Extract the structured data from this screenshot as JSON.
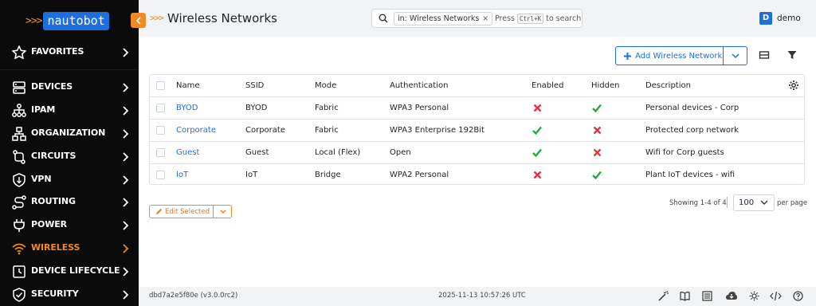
{
  "brand": {
    "chevrons": ">>>",
    "name": "nautobot"
  },
  "sidebar": {
    "favorites": "FAVORITES",
    "items": [
      {
        "label": "DEVICES",
        "icon": "server-icon"
      },
      {
        "label": "IPAM",
        "icon": "ipam-icon"
      },
      {
        "label": "ORGANIZATION",
        "icon": "organization-icon"
      },
      {
        "label": "CIRCUITS",
        "icon": "circuit-icon"
      },
      {
        "label": "VPN",
        "icon": "vpn-shield-icon"
      },
      {
        "label": "ROUTING",
        "icon": "routing-icon"
      },
      {
        "label": "POWER",
        "icon": "power-plug-icon"
      },
      {
        "label": "WIRELESS",
        "icon": "wifi-icon",
        "active": true
      },
      {
        "label": "DEVICE LIFECYCLE",
        "icon": "lifecycle-icon"
      },
      {
        "label": "SECURITY",
        "icon": "shield-check-icon"
      }
    ]
  },
  "header": {
    "title_chevrons": ">>>",
    "title": "Wireless Networks",
    "search": {
      "chip": "in: Wireless Networks",
      "chip_close": "×",
      "press": "Press",
      "kbd": "Ctrl+K",
      "to_search": "to search"
    },
    "user": {
      "initial": "D",
      "name": "demo"
    }
  },
  "toolbar": {
    "add_label": "Add Wireless Network"
  },
  "table": {
    "columns": [
      "Name",
      "SSID",
      "Mode",
      "Authentication",
      "Enabled",
      "Hidden",
      "Description"
    ],
    "rows": [
      {
        "name": "BYOD",
        "ssid": "BYOD",
        "mode": "Fabric",
        "auth": "WPA3 Personal",
        "enabled": false,
        "hidden": true,
        "description": "Personal devices - Corp"
      },
      {
        "name": "Corporate",
        "ssid": "Corporate",
        "mode": "Fabric",
        "auth": "WPA3 Enterprise 192Bit",
        "enabled": true,
        "hidden": false,
        "description": "Protected corp network"
      },
      {
        "name": "Guest",
        "ssid": "Guest",
        "mode": "Local (Flex)",
        "auth": "Open",
        "enabled": true,
        "hidden": false,
        "description": "Wifi for Corp guests"
      },
      {
        "name": "IoT",
        "ssid": "IoT",
        "mode": "Bridge",
        "auth": "WPA2 Personal",
        "enabled": false,
        "hidden": true,
        "description": "Plant IoT devices - wifi"
      }
    ]
  },
  "actions": {
    "edit_selected": "Edit Selected"
  },
  "pagination": {
    "showing": "Showing 1-4 of 4",
    "per_page_value": "100",
    "per_page_label": "per page"
  },
  "footer": {
    "version": "dbd7a2e5f80e (v3.0.0rc2)",
    "timestamp": "2025-11-13 10:57:26 UTC"
  },
  "colors": {
    "accent": "#f08a24",
    "primary": "#1d6fe0",
    "success": "#28a745",
    "danger": "#dc3545",
    "sidebar_bg": "#0b0b0c"
  }
}
